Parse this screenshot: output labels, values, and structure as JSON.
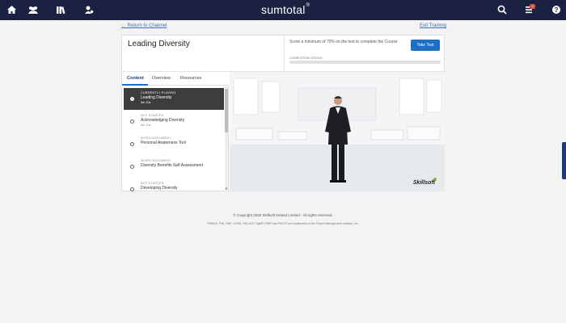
{
  "app": {
    "brand": "sumtotal",
    "brand_mark": "®",
    "notification_count": "3"
  },
  "nav": {
    "icons": [
      "home-icon",
      "people-icon",
      "library-icon",
      "user-group-icon",
      "search-icon",
      "checklist-icon",
      "help-icon"
    ],
    "back_link": "Return to Channel",
    "exit_link": "Exit Training"
  },
  "course": {
    "title": "Leading Diversity",
    "score_text": "Score a minimum of 70% on the test to complete the Course",
    "take_test_label": "Take Test",
    "completion_label": "COMPLETION STATUS",
    "completion_fraction": 0.0
  },
  "tabs": [
    {
      "label": "Content",
      "active": true
    },
    {
      "label": "Overview",
      "active": false
    },
    {
      "label": "Resources",
      "active": false
    }
  ],
  "items": [
    {
      "status": "CURRENTLY PLAYING",
      "name": "Leading Diversity",
      "duration": "5m 20s",
      "current": true
    },
    {
      "status": "NOT STARTED",
      "name": "Acknowledging Diversity",
      "duration": "5m 20s",
      "current": false
    },
    {
      "status": "WORD DOCUMENT",
      "name": "Personal Awareness Tool",
      "duration": "",
      "current": false
    },
    {
      "status": "WORD DOCUMENT",
      "name": "Diversity Benefits Self Assessment",
      "duration": "",
      "current": false
    },
    {
      "status": "NOT STARTED",
      "name": "Developing Diversity",
      "duration": "",
      "current": false
    }
  ],
  "video": {
    "watermark": "Skillsoft"
  },
  "footer": {
    "copyright": "© Copyright 2020 Skillsoft Ireland Limited - All rights reserved.",
    "trademarks": "PMBOK, PMI, PMP, CAPM, PMI-ACP, PgMP, PfMP and PMI-SP are trademarks of the Project Management Institute, Inc."
  },
  "colors": {
    "topbar": "#1b2141",
    "accent": "#1d6fc4",
    "link": "#3a70b5"
  }
}
